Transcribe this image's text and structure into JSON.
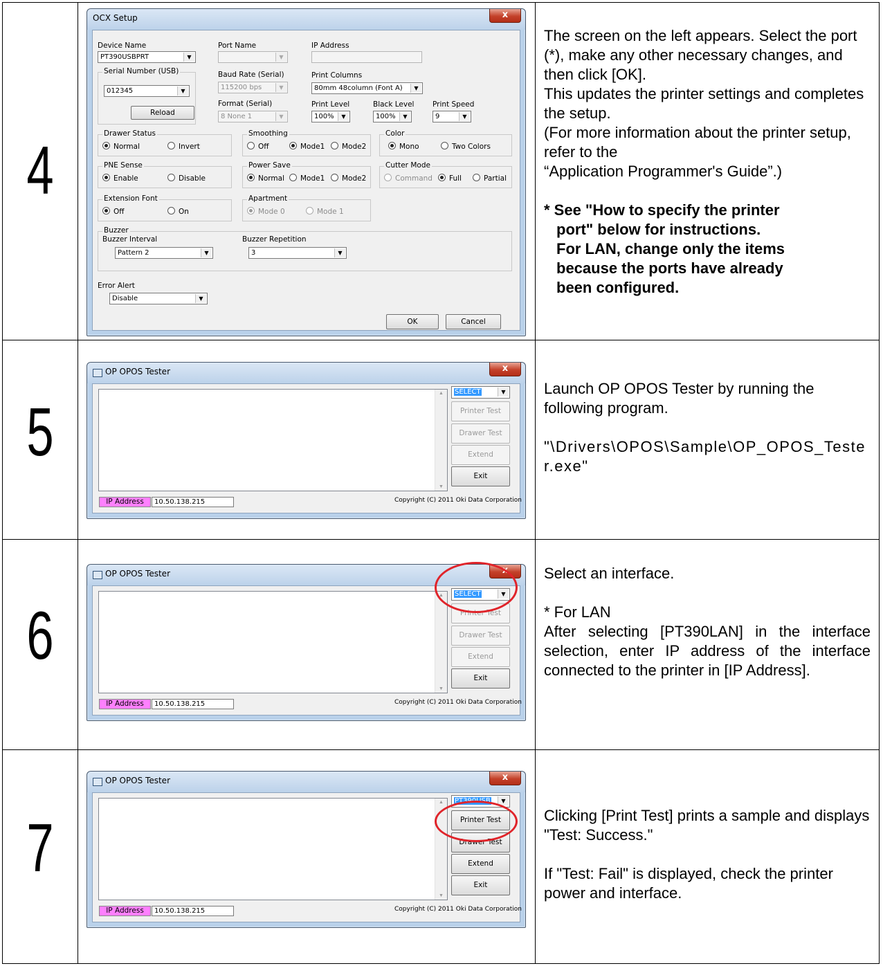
{
  "rows": [
    {
      "number": "4",
      "ocx": {
        "title": "OCX Setup",
        "close": "x",
        "device_name_label": "Device Name",
        "device_name": "PT390USBPRT",
        "port_name_label": "Port Name",
        "port_name": "",
        "ip_address_label": "IP Address",
        "ip_address": "",
        "serial_group_label": "Serial Number  (USB)",
        "serial_number": "012345",
        "reload_button": "Reload",
        "baud_rate_label": "Baud Rate  (Serial)",
        "baud_rate": "115200 bps",
        "format_label": "Format   (Serial)",
        "format": "8 None 1",
        "print_columns_label": "Print Columns",
        "print_columns": "80mm 48column (Font A)",
        "print_level_label": "Print Level",
        "print_level": "100%",
        "black_level_label": "Black Level",
        "black_level": "100%",
        "print_speed_label": "Print Speed",
        "print_speed": "9",
        "drawer_status_label": "Drawer Status",
        "drawer_normal": "Normal",
        "drawer_invert": "Invert",
        "smoothing_label": "Smoothing",
        "smoothing_off": "Off",
        "smoothing_mode1": "Mode1",
        "smoothing_mode2": "Mode2",
        "color_label": "Color",
        "color_mono": "Mono",
        "color_two": "Two Colors",
        "pne_label": "PNE Sense",
        "pne_enable": "Enable",
        "pne_disable": "Disable",
        "power_save_label": "Power Save",
        "power_normal": "Normal",
        "power_mode1": "Mode1",
        "power_mode2": "Mode2",
        "cutter_label": "Cutter Mode",
        "cutter_command": "Command",
        "cutter_full": "Full",
        "cutter_partial": "Partial",
        "ext_font_label": "Extension Font",
        "ext_off": "Off",
        "ext_on": "On",
        "apartment_label": "Apartment",
        "apartment_mode0": "Mode 0",
        "apartment_mode1": "Mode 1",
        "buzzer_label": "Buzzer",
        "buzzer_interval_label": "Buzzer Interval",
        "buzzer_interval": "Pattern 2",
        "buzzer_repetition_label": "Buzzer Repetition",
        "buzzer_repetition": "3",
        "error_alert_label": "Error Alert",
        "error_alert": "Disable",
        "ok_button": "OK",
        "cancel_button": "Cancel"
      },
      "text": {
        "p1": "The screen on the left appears. Select the port (*), make any other necessary changes, and then click [OK].",
        "p2": "This updates the printer settings and completes the setup.",
        "p3": "(For more information about the printer setup, refer to the",
        "p4": "“Application Programmer's Guide”.)",
        "note_line1": "* See \"How to specify the printer",
        "note_line2": "port\" below for instructions.",
        "note_line3": "For LAN, change only the items",
        "note_line4": "because the ports have already",
        "note_line5": "been configured."
      }
    },
    {
      "number": "5",
      "tester": {
        "title": "OP OPOS Tester",
        "close": "x",
        "select": "SELECT",
        "printer_test": "Printer Test",
        "drawer_test": "Drawer Test",
        "extend": "Extend",
        "exit": "Exit",
        "ip_label": "IP Address",
        "ip_value": "10.50.138.215",
        "copyright": "Copyright (C) 2011 Oki Data Corporation"
      },
      "text": {
        "p1": "Launch OP OPOS Tester by running the following program.",
        "p2": "\"\\Drivers\\OPOS\\Sample\\OP_OPOS_Tester.exe\""
      }
    },
    {
      "number": "6",
      "tester": {
        "title": "OP OPOS Tester",
        "close": "x",
        "select": "SELECT",
        "printer_test": "Printer Test",
        "drawer_test": "Drawer Test",
        "extend": "Extend",
        "exit": "Exit",
        "ip_label": "IP Address",
        "ip_value": "10.50.138.215",
        "copyright": "Copyright (C) 2011 Oki Data Corporation"
      },
      "text": {
        "p1": "Select an interface.",
        "p2": "* For LAN",
        "p3": "After selecting [PT390LAN] in the interface selection, enter IP address of the interface connected to the printer in [IP Address]."
      }
    },
    {
      "number": "7",
      "tester": {
        "title": "OP OPOS Tester",
        "close": "x",
        "select": "PT390USB",
        "printer_test": "Printer Test",
        "drawer_test": "Drawer Test",
        "extend": "Extend",
        "exit": "Exit",
        "ip_label": "IP Address",
        "ip_value": "10.50.138.215",
        "copyright": "Copyright (C) 2011 Oki Data Corporation"
      },
      "text": {
        "p1": "Clicking [Print Test] prints a sample and displays \"Test: Success.\"",
        "p2": "If \"Test: Fail\" is displayed, check the printer power and interface."
      }
    }
  ]
}
